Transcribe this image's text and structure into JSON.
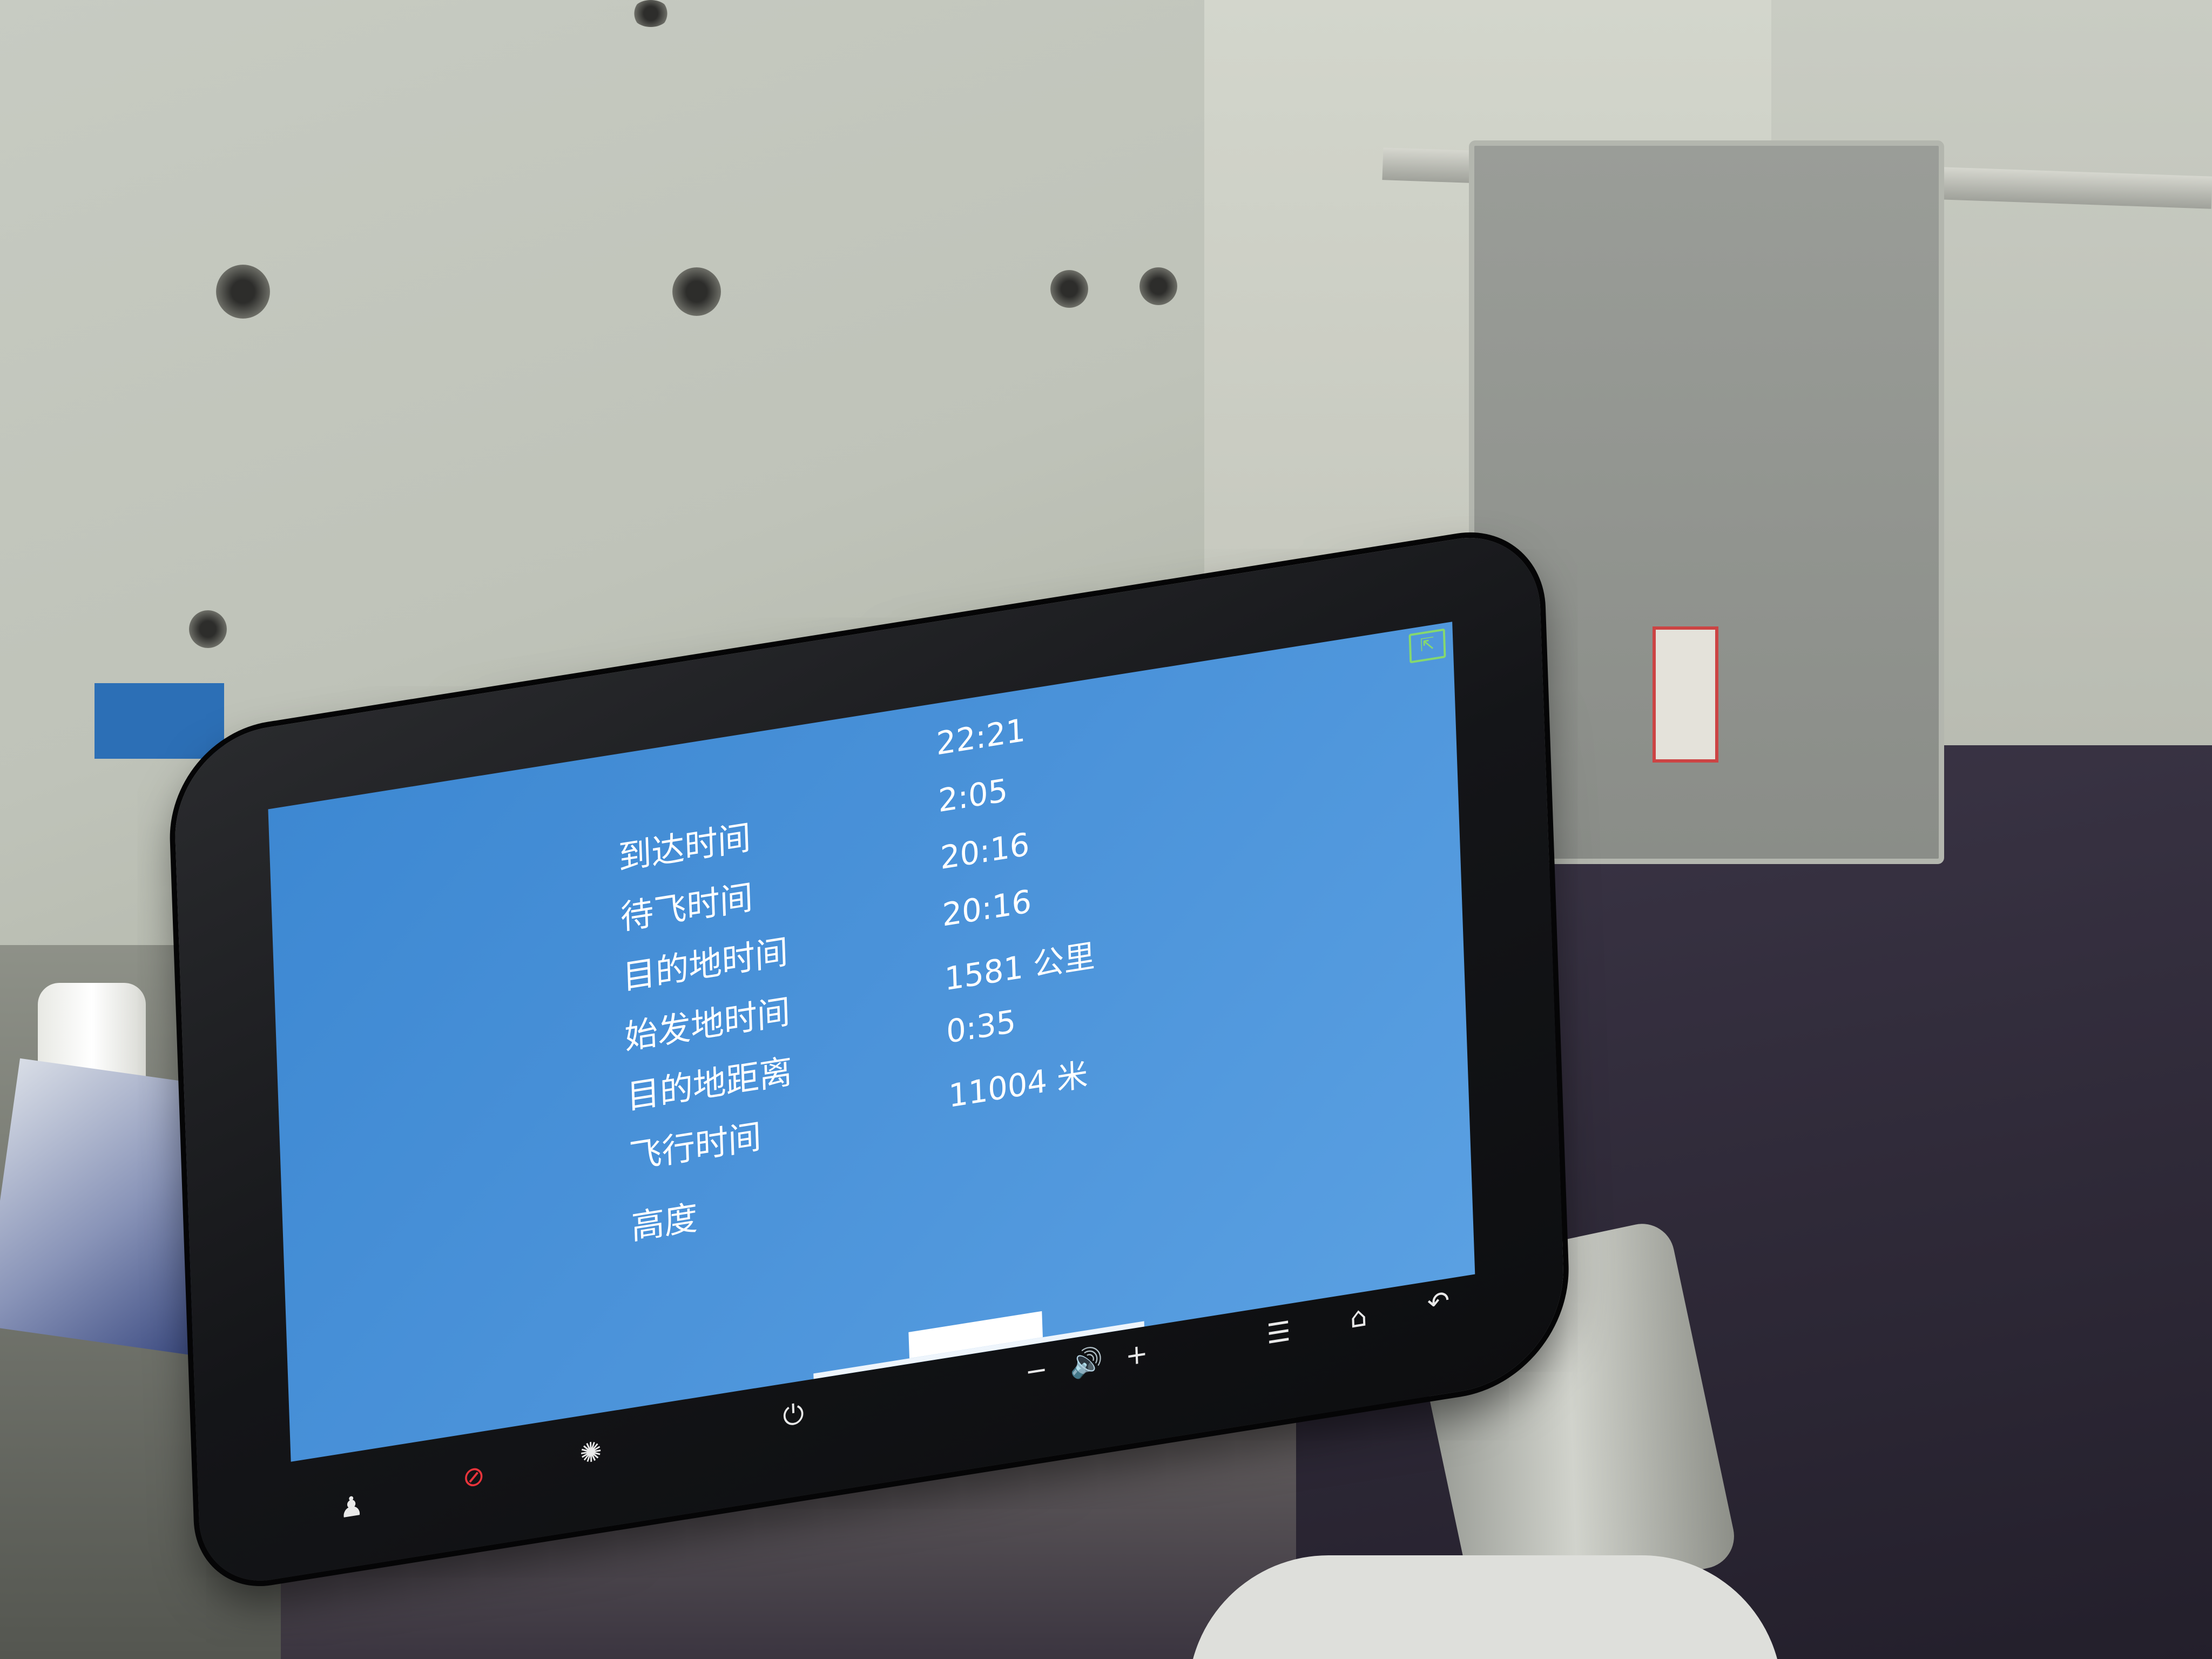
{
  "screen": {
    "rows": [
      {
        "label": "到达时间",
        "value": "22:21"
      },
      {
        "label": "待飞时间",
        "value": "2:05"
      },
      {
        "label": "目的地时间",
        "value": "20:16"
      },
      {
        "label": "始发地时间",
        "value": "20:16"
      },
      {
        "label": "目的地距离",
        "value": "1581 公里"
      },
      {
        "label": "飞行时间",
        "value": "0:35"
      },
      {
        "label": "高度",
        "value": "11004 米"
      }
    ],
    "exit_icon": "exit-icon",
    "progress": 0.5
  },
  "controls": {
    "attendant_icon": "attendant-call-icon",
    "cancel_call_icon": "cancel-call-icon",
    "reading_light_icon": "reading-light-icon",
    "power_icon": "power-icon",
    "volume_down": "−",
    "volume_icon": "🔊",
    "volume_up": "+",
    "menu_icon": "menu-icon",
    "home_icon": "home-icon",
    "back_icon": "back-icon"
  },
  "colors": {
    "screen_blue": "#4a92d9",
    "cancel_call_red": "#e8343b",
    "exit_green": "#86d86e"
  }
}
